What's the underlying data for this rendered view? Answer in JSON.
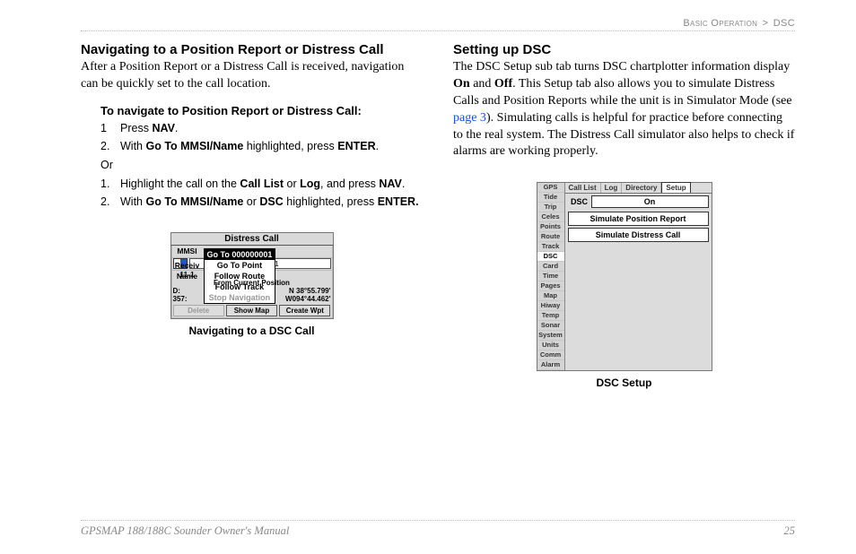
{
  "header": {
    "breadcrumb_left": "Basic Operation",
    "sep": ">",
    "breadcrumb_right": "DSC"
  },
  "left": {
    "h": "Navigating to a Position Report or Distress Call",
    "p": "After a Position Report or a Distress Call is received, navigation can be quickly set to the call location.",
    "sub": "To navigate to Position Report or Distress Call:",
    "s1n": "1",
    "s1a": "Press ",
    "s1b": "NAV",
    "s1c": ".",
    "s2n": "2.",
    "s2a": "With ",
    "s2b": "Go To MMSI/Name",
    "s2c": " highlighted, press ",
    "s2d": "ENTER",
    "s2e": ".",
    "or": "Or",
    "s3n": "1.",
    "s3a": "Highlight the call on the ",
    "s3b": "Call List",
    "s3c": " or ",
    "s3d": "Log",
    "s3e": ", and press ",
    "s3f": "NAV",
    "s3g": ".",
    "s4n": "2.",
    "s4a": "With ",
    "s4b": "Go To MMSI/Name",
    "s4c": " or ",
    "s4d": "DSC",
    "s4e": " highlighted, press ",
    "s4f": "ENTER.",
    "fig": {
      "title": "Distress Call",
      "mmsi_label": "MMSI",
      "mmsi_value": "000000001",
      "name_label": "Name",
      "menu": [
        "Go To 000000001",
        "Go To Point",
        "Follow Route",
        "Follow Track",
        "Stop Navigation"
      ],
      "receiv_label": "Receiv",
      "time_label": "11-1",
      "fcp": "From Current Position",
      "d_label": "D:",
      "brg_label": "357:",
      "lat": "N 38°55.799'",
      "lon": "W094°44.462'",
      "btn_delete": "Delete",
      "btn_showmap": "Show Map",
      "btn_create": "Create Wpt",
      "caption": "Navigating to a DSC Call"
    }
  },
  "right": {
    "h": "Setting up DSC",
    "p1": "The DSC Setup sub tab turns DSC chartplotter information display ",
    "onword": "On",
    "and": " and ",
    "offword": "Off",
    "p2": ". This Setup tab also allows you to simulate Distress Calls and Position Reports while the unit is in Simulator Mode (see ",
    "link": "page 3",
    "p3": "). Simulating calls is helpful for practice before connecting to the real system. The Distress Call simulator also helps to check if alarms are working properly.",
    "fig": {
      "sidetabs": [
        "GPS",
        "Tide",
        "Trip",
        "Celes",
        "Points",
        "Route",
        "Track",
        "DSC",
        "Card",
        "Time",
        "Pages",
        "Map",
        "Hiway",
        "Temp",
        "Sonar",
        "System",
        "Units",
        "Comm",
        "Alarm"
      ],
      "sel_index": 7,
      "tabs": [
        "Call List",
        "Log",
        "Directory",
        "Setup"
      ],
      "dsc_label": "DSC",
      "dsc_value": "On",
      "btn1": "Simulate Position Report",
      "btn2": "Simulate Distress Call",
      "caption": "DSC Setup"
    }
  },
  "footer": {
    "manual": "GPSMAP 188/188C Sounder Owner's Manual",
    "page": "25"
  }
}
